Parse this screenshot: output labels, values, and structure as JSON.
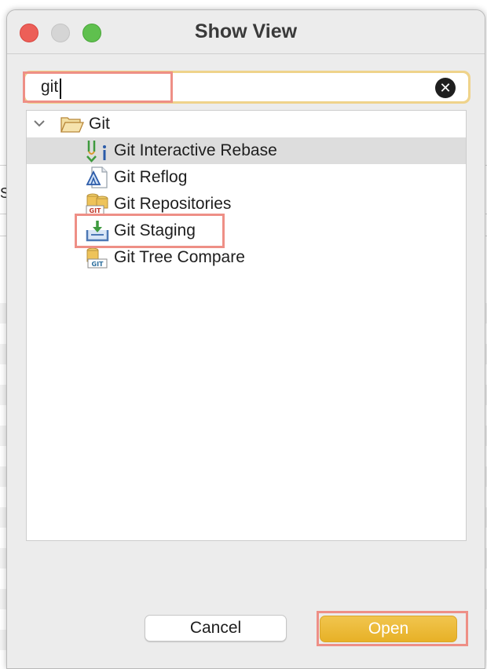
{
  "window": {
    "title": "Show View"
  },
  "background": {
    "partial_text": "S"
  },
  "search": {
    "value": "git"
  },
  "tree": {
    "root": {
      "label": "Git",
      "icon": "folder-open-icon"
    },
    "items": [
      {
        "label": "Git Interactive Rebase",
        "icon": "interactive-rebase-icon",
        "selected": true
      },
      {
        "label": "Git Reflog",
        "icon": "reflog-icon",
        "selected": false
      },
      {
        "label": "Git Repositories",
        "icon": "repositories-icon",
        "selected": false
      },
      {
        "label": "Git Staging",
        "icon": "staging-icon",
        "selected": false
      },
      {
        "label": "Git Tree Compare",
        "icon": "tree-compare-icon",
        "selected": false
      }
    ]
  },
  "buttons": {
    "cancel": "Cancel",
    "open": "Open"
  },
  "colors": {
    "accent": "#e9b52e",
    "selection": "#dddddd",
    "highlight": "#ee8f86",
    "search_ring": "#efd38b"
  }
}
